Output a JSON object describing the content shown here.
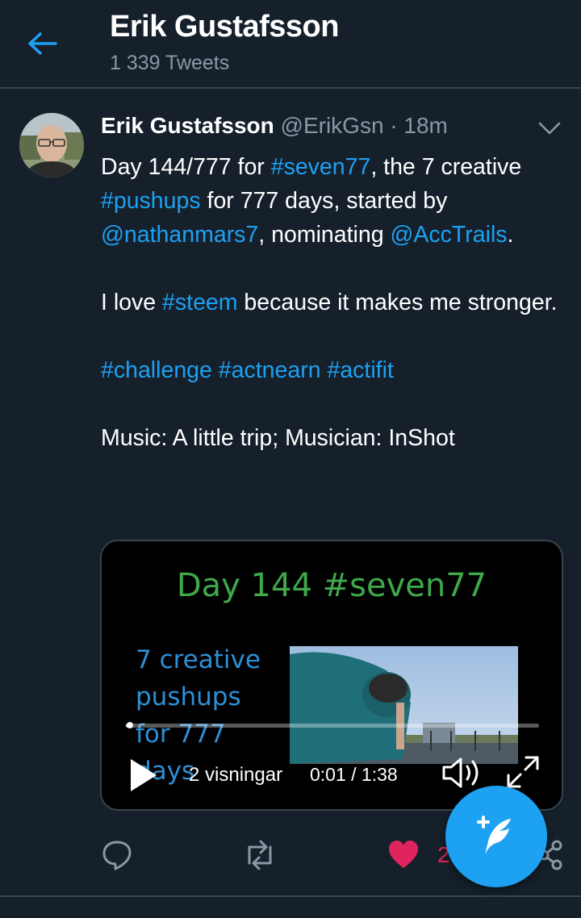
{
  "header": {
    "title": "Erik Gustafsson",
    "subtitle": "1 339 Tweets",
    "back_icon": "arrow-left-icon"
  },
  "tweet": {
    "author_name": "Erik Gustafsson",
    "handle": "@ErikGsn",
    "dot": "·",
    "time": "18m",
    "line1": {
      "t1": "Day 144/777 for ",
      "tag1": "#seven77",
      "t2": ", the 7 creative ",
      "tag2": "#pushups",
      "t3": " for 777 days, started by ",
      "mention1": "@nathanmars7",
      "t4": ", nominating ",
      "mention2": "@AccTrails",
      "t5": "."
    },
    "line2": {
      "t1": "I love ",
      "tag": "#steem",
      "t2": " because it makes me stronger."
    },
    "hashtags": "#challenge #actnearn #actifit",
    "music": "Music: A little trip; Musician: InShot"
  },
  "video": {
    "title_text": "Day 144 #seven77",
    "side_lines": [
      "7 creative",
      "pushups",
      "for 777",
      "days"
    ],
    "views": "2 visningar",
    "time": "0:01 / 1:38",
    "progress": 0.01
  },
  "actions": {
    "like_count": "2"
  },
  "colors": {
    "background": "#15202b",
    "accent": "#1da1f2",
    "like": "#e0245e",
    "muted": "#8899a6",
    "divider": "#38444d"
  }
}
